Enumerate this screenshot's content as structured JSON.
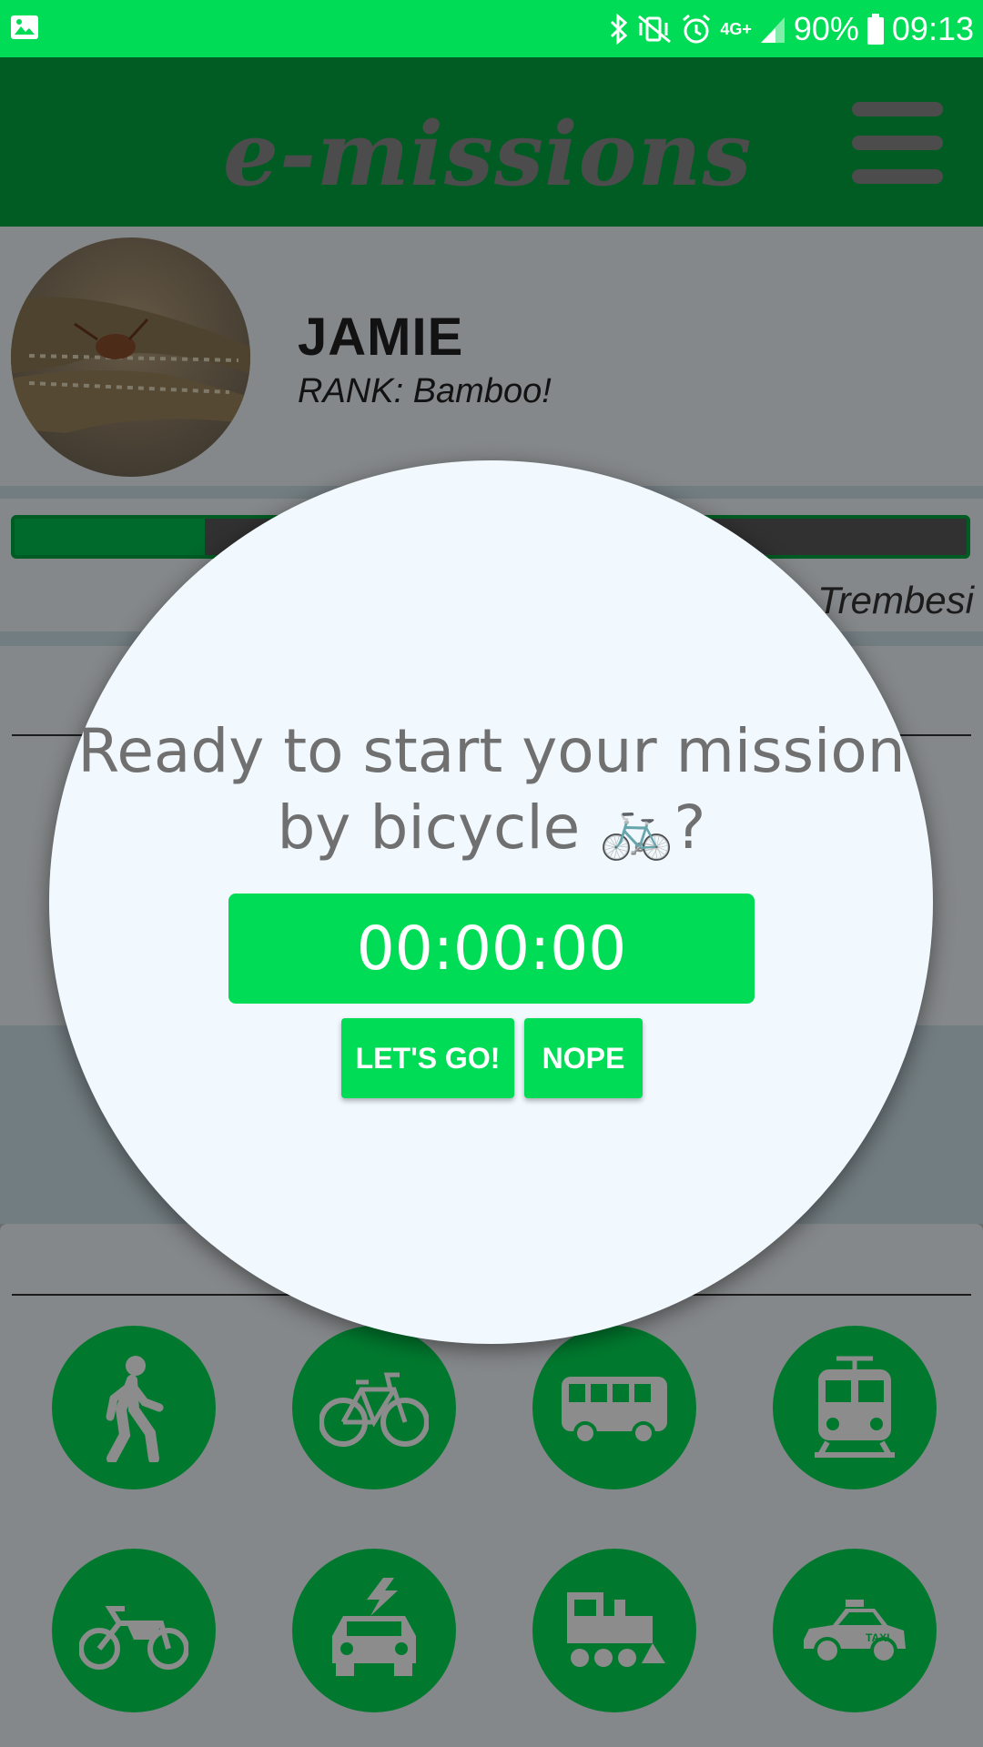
{
  "status_bar": {
    "battery": "90%",
    "time": "09:13",
    "network": "4G+"
  },
  "app": {
    "title": "e-missions",
    "menu_icon": "hamburger-menu-icon"
  },
  "profile": {
    "name": "JAMIE",
    "rank": "RANK: Bamboo!"
  },
  "progress": {
    "fraction": 0.2,
    "next_rank": "Trembesi"
  },
  "dialog": {
    "prompt": "Ready to start your mission by bicycle 🚲?",
    "timer": "00:00:00",
    "confirm_label": "LET'S GO!",
    "cancel_label": "NOPE"
  },
  "transport_modes": [
    "walk",
    "bicycle",
    "bus",
    "tram",
    "motorbike",
    "electric-car",
    "train",
    "taxi"
  ],
  "colors": {
    "accent": "#00dc55",
    "appbar": "#00a840",
    "dialog_bg": "#f1f9ff",
    "text_gray": "#707070"
  },
  "taxi_sign": "TAXI"
}
